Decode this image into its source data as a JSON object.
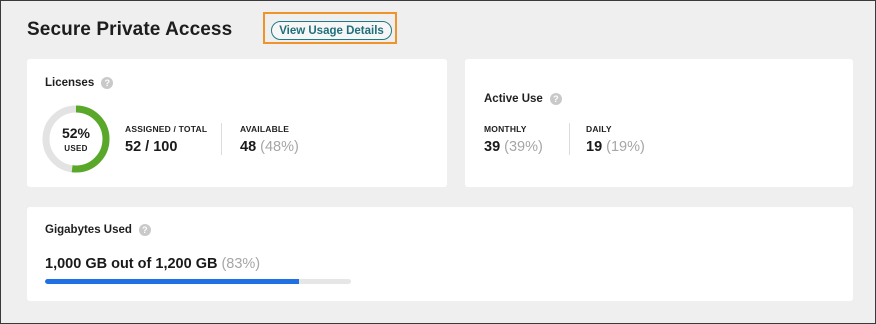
{
  "header": {
    "title": "Secure Private Access",
    "usage_button_label": "View Usage Details"
  },
  "licenses": {
    "title": "Licenses",
    "help_icon": "question-circle-icon",
    "used_percent_text": "52%",
    "used_label": "USED",
    "used_fraction": 0.52,
    "assigned_total_label": "ASSIGNED / TOTAL",
    "assigned_total_value": "52 / 100",
    "available_label": "AVAILABLE",
    "available_value": "48",
    "available_pct": "(48%)"
  },
  "active_use": {
    "title": "Active Use",
    "help_icon": "question-circle-icon",
    "monthly_label": "MONTHLY",
    "monthly_value": "39",
    "monthly_pct": "(39%)",
    "daily_label": "DAILY",
    "daily_value": "19",
    "daily_pct": "(19%)"
  },
  "gigabytes": {
    "title": "Gigabytes Used",
    "help_icon": "question-circle-icon",
    "summary": "1,000 GB out of 1,200 GB",
    "summary_pct": "(83%)",
    "used_fraction": 0.83
  },
  "colors": {
    "ring_fill": "#5aa82a",
    "ring_track": "#e3e3e3",
    "progress_fill": "#1f6fe5",
    "accent": "#1f7a85",
    "highlight": "#f0932b"
  }
}
